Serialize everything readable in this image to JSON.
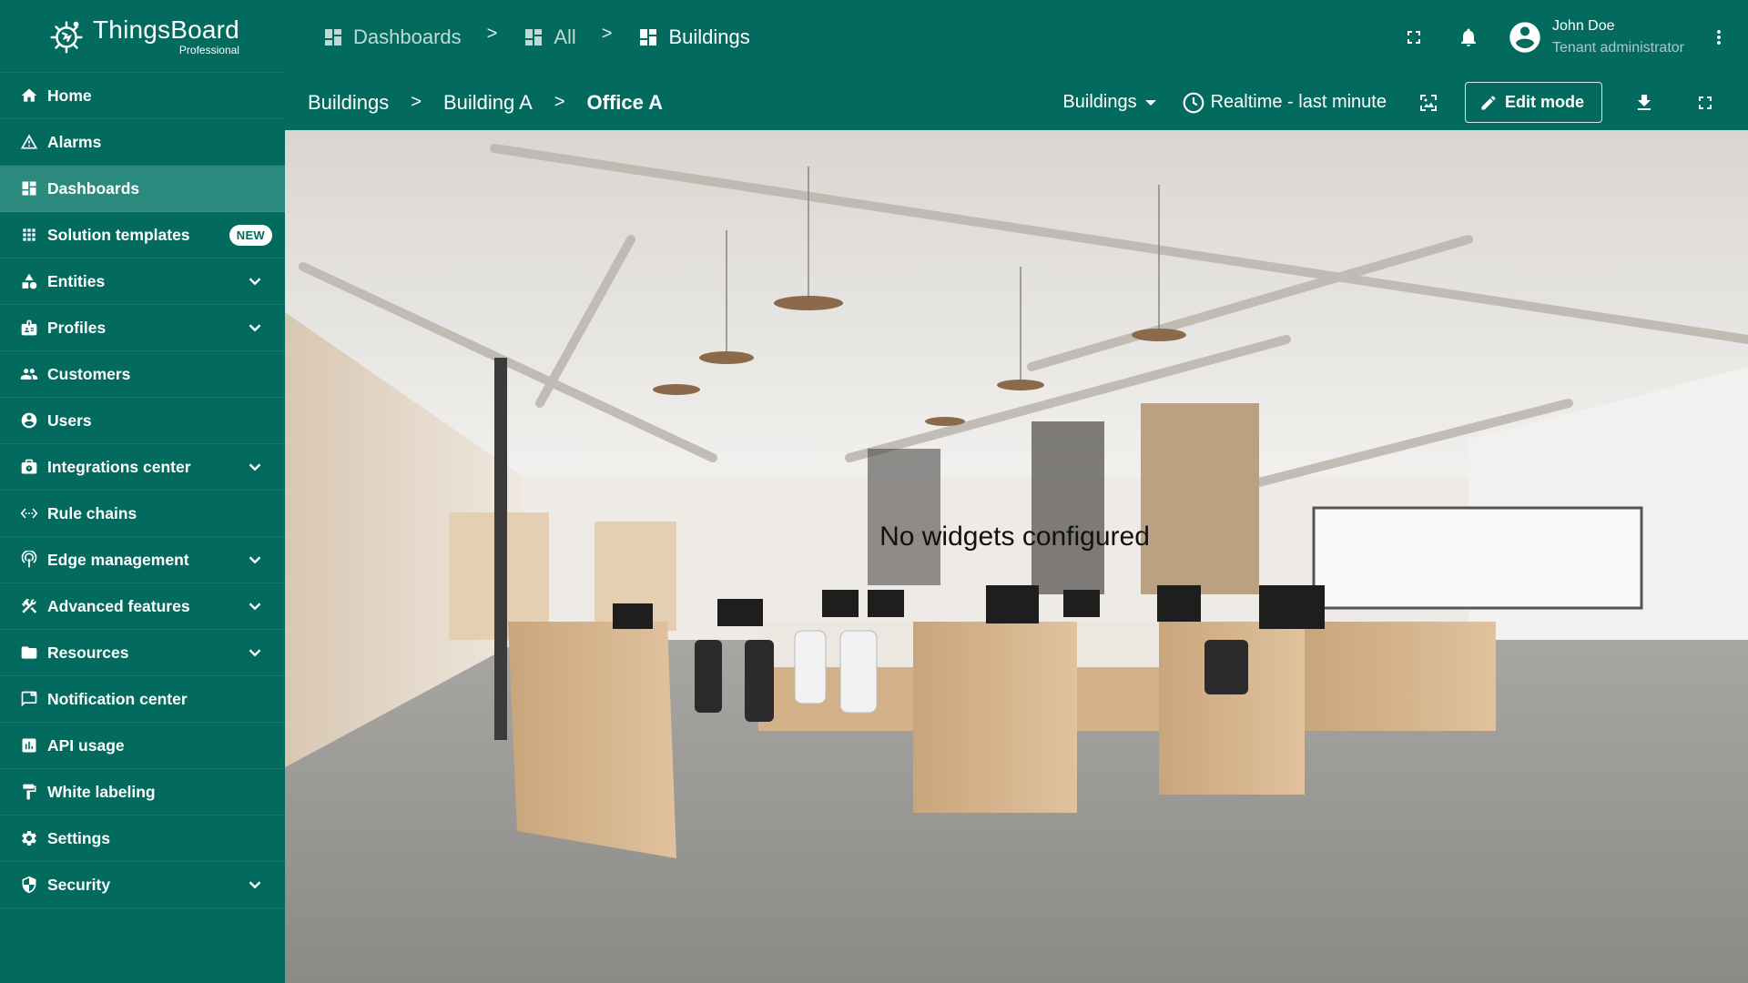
{
  "app": {
    "logo_name": "ThingsBoard",
    "logo_edition": "Professional",
    "accent_color": "#036a5e",
    "active_item_color": "#2a8a7e"
  },
  "sidebar": {
    "items": [
      {
        "label": "Home",
        "icon": "home-icon",
        "active": false,
        "expandable": false
      },
      {
        "label": "Alarms",
        "icon": "warning-icon",
        "active": false,
        "expandable": false
      },
      {
        "label": "Dashboards",
        "icon": "dashboard-icon",
        "active": true,
        "expandable": false
      },
      {
        "label": "Solution templates",
        "icon": "apps-grid-icon",
        "active": false,
        "expandable": false,
        "badge": "NEW"
      },
      {
        "label": "Entities",
        "icon": "shapes-icon",
        "active": false,
        "expandable": true
      },
      {
        "label": "Profiles",
        "icon": "badge-icon",
        "active": false,
        "expandable": true
      },
      {
        "label": "Customers",
        "icon": "people-icon",
        "active": false,
        "expandable": false
      },
      {
        "label": "Users",
        "icon": "account-circle-icon",
        "active": false,
        "expandable": false
      },
      {
        "label": "Integrations center",
        "icon": "integration-icon",
        "active": false,
        "expandable": true
      },
      {
        "label": "Rule chains",
        "icon": "settings-ethernet-icon",
        "active": false,
        "expandable": false
      },
      {
        "label": "Edge management",
        "icon": "router-icon",
        "active": false,
        "expandable": true
      },
      {
        "label": "Advanced features",
        "icon": "construction-icon",
        "active": false,
        "expandable": true
      },
      {
        "label": "Resources",
        "icon": "folder-icon",
        "active": false,
        "expandable": true
      },
      {
        "label": "Notification center",
        "icon": "mark-chat-icon",
        "active": false,
        "expandable": false
      },
      {
        "label": "API usage",
        "icon": "insert-chart-icon",
        "active": false,
        "expandable": false
      },
      {
        "label": "White labeling",
        "icon": "format-paint-icon",
        "active": false,
        "expandable": false
      },
      {
        "label": "Settings",
        "icon": "gear-icon",
        "active": false,
        "expandable": false
      },
      {
        "label": "Security",
        "icon": "security-shield-icon",
        "active": false,
        "expandable": true
      }
    ]
  },
  "header": {
    "breadcrumb": [
      {
        "label": "Dashboards",
        "icon": "dashboard-icon"
      },
      {
        "label": "All",
        "icon": "dashboard-icon"
      },
      {
        "label": "Buildings",
        "icon": "dashboard-icon"
      }
    ],
    "separator": ">",
    "user": {
      "name": "John Doe",
      "role": "Tenant administrator"
    }
  },
  "dashboard_toolbar": {
    "state_breadcrumb": [
      "Buildings",
      "Building A",
      "Office A"
    ],
    "separator": ">",
    "states_select": "Buildings",
    "timewindow": "Realtime - last minute",
    "edit_label": "Edit mode"
  },
  "canvas": {
    "empty_message": "No widgets configured",
    "background_description": "office-interior-photo"
  }
}
